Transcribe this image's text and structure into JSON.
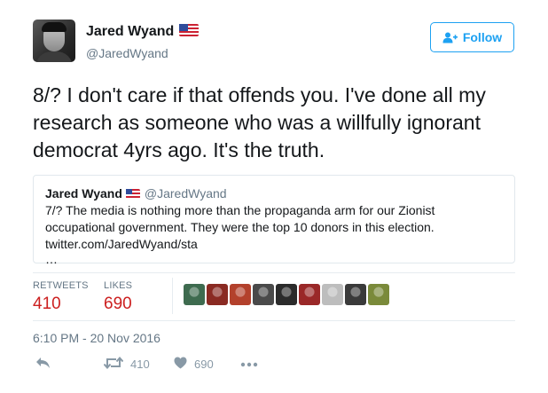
{
  "author": {
    "name": "Jared Wyand",
    "handle": "@JaredWyand"
  },
  "follow_label": "Follow",
  "tweet": {
    "text": "8/? I don't care if that offends you. I've done all my research as someone who was a willfully ignorant democrat 4yrs ago. It's the truth."
  },
  "quoted": {
    "name": "Jared Wyand",
    "handle": "@JaredWyand",
    "text": "7/? The media is nothing more than the propaganda arm for our Zionist occupational government. They were the top 10 donors in this election. twitter.com/JaredWyand/sta",
    "ellipsis": "…"
  },
  "stats": {
    "retweets_label": "RETWEETS",
    "retweets": "410",
    "likes_label": "LIKES",
    "likes": "690"
  },
  "timestamp": "6:10 PM - 20 Nov 2016",
  "actions": {
    "retweet_count": "410",
    "like_count": "690"
  },
  "colors": {
    "accent": "#1da1f2",
    "stat_value": "#cc1f1f",
    "liker_avatars": [
      "#3e6b4f",
      "#8a2a22",
      "#b3412c",
      "#4a4a4a",
      "#2b2b2b",
      "#9a2828",
      "#bdbdbd",
      "#3a3a3a",
      "#7a8a3a"
    ]
  },
  "icons": [
    "flag-icon",
    "follow-person-icon",
    "reply-icon",
    "retweet-icon",
    "heart-icon",
    "more-icon"
  ]
}
